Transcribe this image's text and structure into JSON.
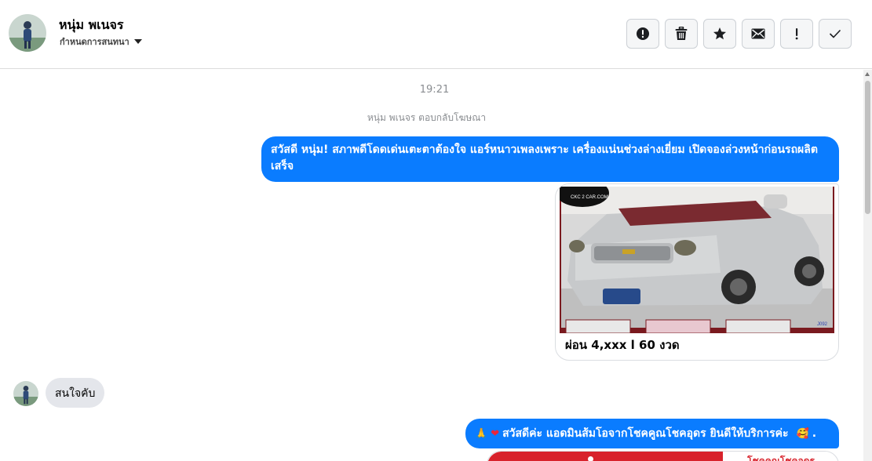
{
  "header": {
    "contact_name": "หนุ่ม พเนจร",
    "subtitle": "กำหนดการสนทนา"
  },
  "actions": [
    {
      "icon": "alert-circle-icon"
    },
    {
      "icon": "trash-icon"
    },
    {
      "icon": "star-icon"
    },
    {
      "icon": "envelope-icon"
    },
    {
      "icon": "exclamation-icon"
    },
    {
      "icon": "check-icon"
    }
  ],
  "chat": {
    "timestamp": "19:21",
    "reply_note": "หนุ่ม พเนจร ตอบกลับโฆษณา",
    "messages": {
      "greeting": "สวัสดี หนุ่ม! สภาพดีโดดเด่นเตะตาต้องใจ แอร์หนาวเพลงเพราะ เครื่องแน่นช่วงล่างเยี่ยม เปิดจองล่วงหน้าก่อนรถผลิตเสร็จ",
      "card_title": "ผ่อน 4,xxx l 60 งวด",
      "card_logo": "CKC 2 CAR.COM",
      "card_tag": "J092",
      "customer_reply": "สนใจคับ",
      "admin_welcome": "สวัสดีค่ะ แอดมินส้มโอจากโชคคูณโชคอุดร ยินดีให้บริการค่ะ",
      "admin_welcome_end": ".",
      "card2_text": "โชคคูณโชคอุดร"
    }
  },
  "colors": {
    "accent": "#0a7cff",
    "incoming_bubble": "#e4e6eb",
    "brand_red": "#d8222b"
  }
}
